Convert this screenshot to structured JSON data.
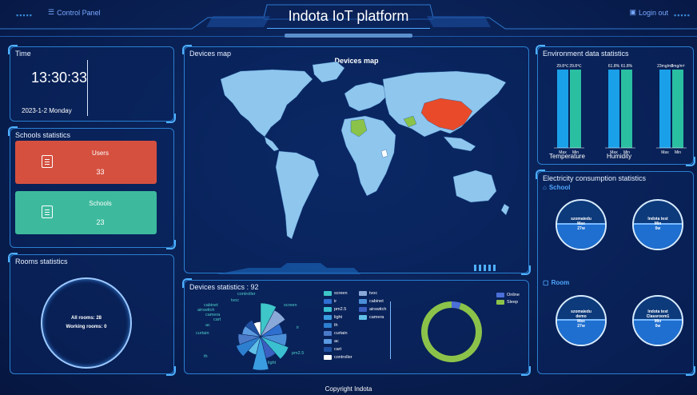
{
  "header": {
    "title": "Indota IoT platform",
    "control_panel": "Control Panel",
    "logout": "Login out"
  },
  "time": {
    "title": "Time",
    "clock": "13:30:33",
    "date": "2023-1-2 Monday"
  },
  "schools_stats": {
    "title": "Schools statistics",
    "users_label": "Users",
    "users_count": "33",
    "schools_label": "Schools",
    "schools_count": "23",
    "users_color": "#d5503f",
    "schools_color": "#3dba9d"
  },
  "rooms_stats": {
    "title": "Rooms statistics",
    "all_rooms": "All rooms:  28",
    "working_rooms": "Working rooms:  0"
  },
  "devices_map": {
    "panel_title": "Devices map",
    "chart_title": "Devices map",
    "highlight_color": "#e84a2a",
    "secondary_color": "#8bc34a",
    "land_color": "#8ec6ee"
  },
  "devices_stats": {
    "title": "Devices statistics : 92",
    "legend": [
      {
        "name": "screen",
        "color": "#3ec6c8"
      },
      {
        "name": "tvoc",
        "color": "#8aa8d8"
      },
      {
        "name": "ir",
        "color": "#2f6fd0"
      },
      {
        "name": "cabinet",
        "color": "#4b8fd8"
      },
      {
        "name": "pm2.5",
        "color": "#3ac0d0"
      },
      {
        "name": "airswitch",
        "color": "#3a5fc0"
      },
      {
        "name": "light",
        "color": "#3a9de0"
      },
      {
        "name": "camera",
        "color": "#60c0e8"
      },
      {
        "name": "th",
        "color": "#2d7fd0"
      },
      {
        "name": "curtain",
        "color": "#4a7ac8"
      },
      {
        "name": "ac",
        "color": "#5a9ae0"
      },
      {
        "name": "cart",
        "color": "#1f4fa0"
      },
      {
        "name": "controller",
        "color": "#ffffff"
      }
    ],
    "pie_labels": [
      "controller",
      "screen",
      "tvoc",
      "cabinet",
      "airswitch",
      "camera",
      "cart",
      "ac",
      "curtain",
      "ir",
      "th",
      "light",
      "pm2.5"
    ],
    "donut_legend": [
      {
        "name": "Online",
        "color": "#4a6fd8"
      },
      {
        "name": "Sleep",
        "color": "#8bc34a"
      }
    ]
  },
  "env": {
    "title": "Environment data statistics",
    "groups": [
      {
        "label": "Temperature",
        "max": "29.8℃",
        "min": "29.8℃"
      },
      {
        "label": "Humidity",
        "max": "61.8%",
        "min": "61.8%"
      },
      {
        "label": "",
        "max": "23mg/m³",
        "min": "3mg/m³"
      }
    ],
    "max_label": "Max",
    "min_label": "Min",
    "max_color": "#1aa0e8",
    "min_color": "#2bbfa2"
  },
  "elec": {
    "title": "Electricity consumption statistics",
    "school_label": "School",
    "room_label": "Room",
    "school": [
      {
        "l1": "szomaiedu",
        "l2": "Max",
        "l3": "27w"
      },
      {
        "l1": "Indota test",
        "l2": "Min",
        "l3": "0w"
      }
    ],
    "room": [
      {
        "l1": "szomaiedu",
        "l2": "demo",
        "l3": "Max",
        "l4": "27w"
      },
      {
        "l1": "Indota test",
        "l2": "Classroom1",
        "l3": "Min",
        "l4": "0w"
      }
    ]
  },
  "footer": {
    "copyright": "Copyright Indota"
  },
  "chart_data": [
    {
      "type": "pie",
      "title": "",
      "categories": [
        "screen",
        "tvoc",
        "ir",
        "cabinet",
        "pm2.5",
        "airswitch",
        "light",
        "camera",
        "th",
        "curtain",
        "ac",
        "cart",
        "controller"
      ],
      "values": [
        12,
        10,
        6,
        8,
        10,
        6,
        12,
        4,
        8,
        6,
        4,
        4,
        2
      ]
    },
    {
      "type": "pie",
      "title": "",
      "categories": [
        "Online",
        "Sleep"
      ],
      "values": [
        5,
        95
      ]
    },
    {
      "type": "bar",
      "title": "",
      "categories": [
        "Temperature",
        "Humidity"
      ],
      "series": [
        {
          "name": "Max",
          "values": [
            29.8,
            61.8
          ]
        },
        {
          "name": "Min",
          "values": [
            29.8,
            61.8
          ]
        }
      ]
    }
  ]
}
